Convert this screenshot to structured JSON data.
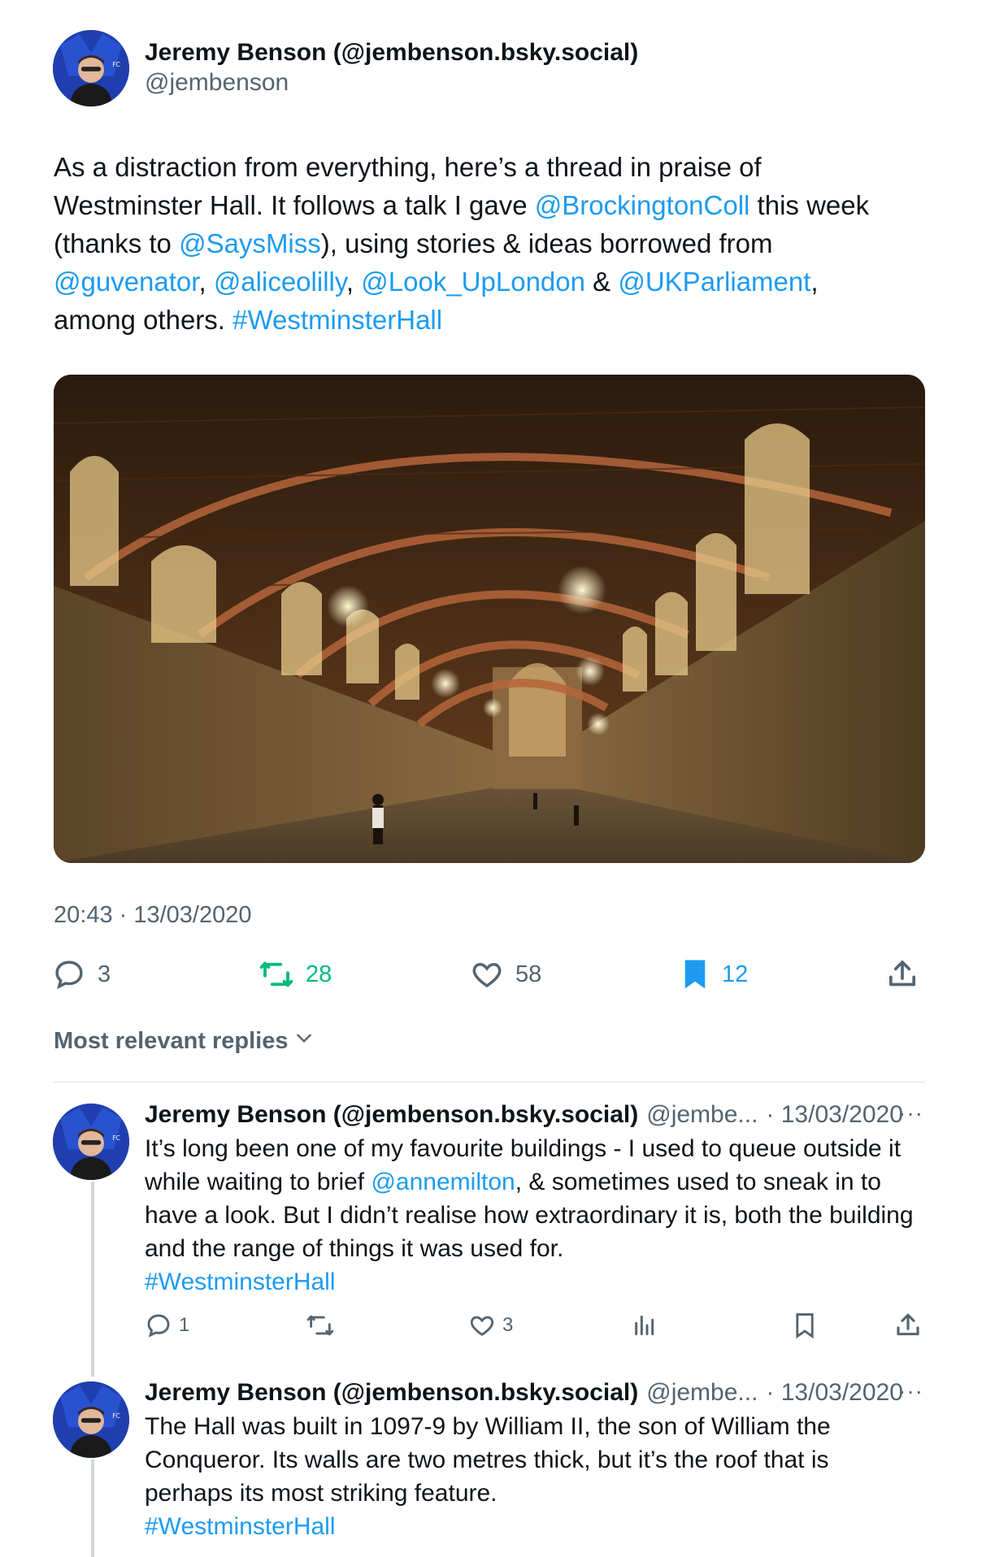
{
  "main_tweet": {
    "author_name": "Jeremy Benson (@jembenson.bsky.social)",
    "author_handle": "@jembenson",
    "text_lines": [
      [
        {
          "t": "As a distraction from everything, here’s a thread in praise of"
        }
      ],
      [
        {
          "t": "Westminster Hall. It follows a talk I gave "
        },
        {
          "t": "@BrockingtonColl",
          "link": true
        },
        {
          "t": " this week"
        }
      ],
      [
        {
          "t": "(thanks to "
        },
        {
          "t": "@SaysMiss",
          "link": true
        },
        {
          "t": "), using stories & ideas borrowed from"
        }
      ],
      [
        {
          "t": "@guvenator",
          "link": true
        },
        {
          "t": ", "
        },
        {
          "t": "@aliceolilly",
          "link": true
        },
        {
          "t": ", "
        },
        {
          "t": "@Look_UpLondon",
          "link": true
        },
        {
          "t": " & "
        },
        {
          "t": "@UKParliament",
          "link": true
        },
        {
          "t": ","
        }
      ],
      [
        {
          "t": "among others. "
        },
        {
          "t": "#WestminsterHall",
          "link": true
        }
      ]
    ],
    "timestamp": "20:43 · 13/03/2020",
    "stats": {
      "replies": "3",
      "retweets": "28",
      "likes": "58",
      "bookmarks": "12"
    }
  },
  "sort_label": "Most relevant replies",
  "replies": [
    {
      "author_name": "Jeremy Benson (@jembenson.bsky.social)",
      "author_handle": "@jembe...",
      "date": "· 13/03/2020",
      "more": "···",
      "text_lines": [
        [
          {
            "t": "It’s long been one of my favourite buildings - I used to queue outside it"
          }
        ],
        [
          {
            "t": "while waiting to brief "
          },
          {
            "t": "@annemilton",
            "link": true
          },
          {
            "t": ", & sometimes used to sneak in to"
          }
        ],
        [
          {
            "t": "have a look. But I didn’t realise how extraordinary it is, both the building"
          }
        ],
        [
          {
            "t": "and the range of things it was used for."
          }
        ],
        [
          {
            "t": "#WestminsterHall",
            "link": true
          }
        ]
      ],
      "stats": {
        "replies": "1",
        "likes": "3"
      }
    },
    {
      "author_name": "Jeremy Benson (@jembenson.bsky.social)",
      "author_handle": "@jembe...",
      "date": "· 13/03/2020",
      "more": "···",
      "text_lines": [
        [
          {
            "t": "The Hall was built in 1097-9 by William II, the son of William the"
          }
        ],
        [
          {
            "t": "Conqueror. Its walls are two metres thick, but it’s the roof that is"
          }
        ],
        [
          {
            "t": "perhaps its most striking feature."
          }
        ],
        [
          {
            "t": "#WestminsterHall",
            "link": true
          }
        ]
      ]
    }
  ],
  "icons": {
    "reply": "speech-bubble-icon",
    "retweet": "retweet-arrows-icon",
    "like": "heart-icon",
    "bookmark": "bookmark-icon",
    "share": "share-upload-icon",
    "views": "bar-chart-icon",
    "sort": "chevron-down-icon"
  },
  "colors": {
    "text": "#0f1419",
    "secondary": "#536471",
    "link": "#1d9bf0",
    "retweet_active": "#00ba7c",
    "bookmark_active": "#1d9bf0"
  }
}
